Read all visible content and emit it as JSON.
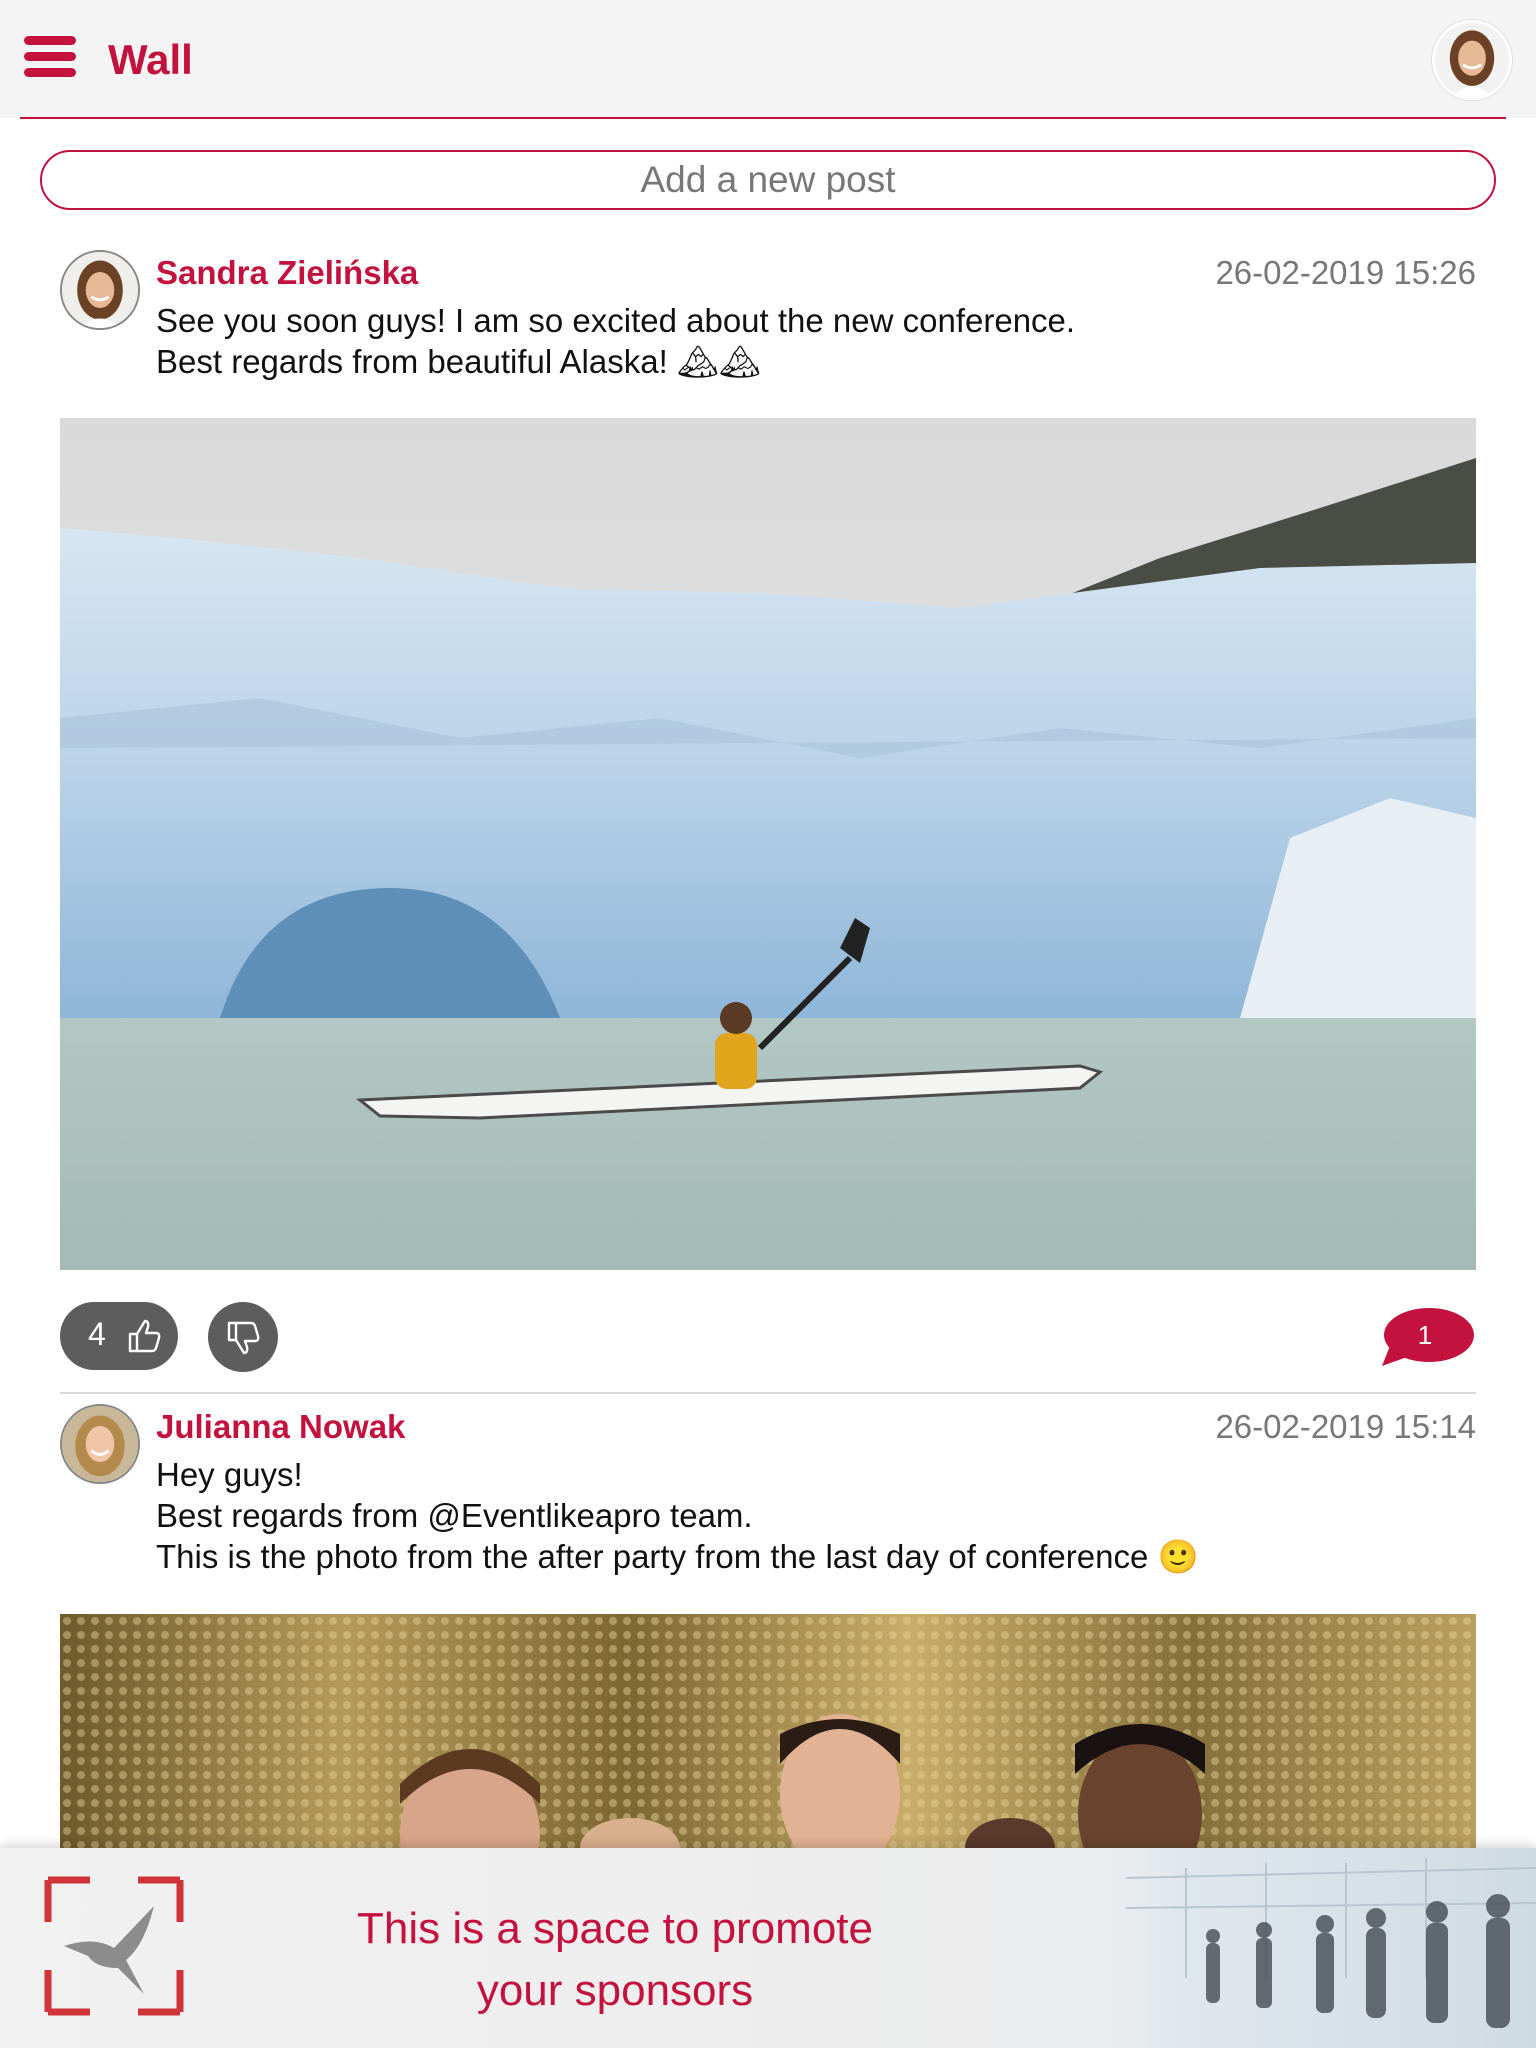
{
  "colors": {
    "accent": "#c3123e",
    "button_gray": "#5d5d5d",
    "muted_text": "#777777"
  },
  "header": {
    "title": "Wall",
    "menu_icon": "hamburger-icon"
  },
  "new_post": {
    "placeholder": "Add a new post"
  },
  "posts": [
    {
      "author": "Sandra Zielińska",
      "timestamp": "26-02-2019 15:26",
      "lines": [
        "See you soon guys! I am so excited about the new conference.",
        "Best regards from beautiful Alaska! 🏔🏔"
      ],
      "likes": "4",
      "comments": "1"
    },
    {
      "author": "Julianna Nowak",
      "timestamp": "26-02-2019 15:14",
      "lines": [
        "Hey guys!",
        "Best regards from @Eventlikeapro team.",
        "This is the photo from the after party from the last day of conference 🙂"
      ]
    }
  ],
  "banner": {
    "line1": "This is a space to promote",
    "line2": "your sponsors"
  }
}
